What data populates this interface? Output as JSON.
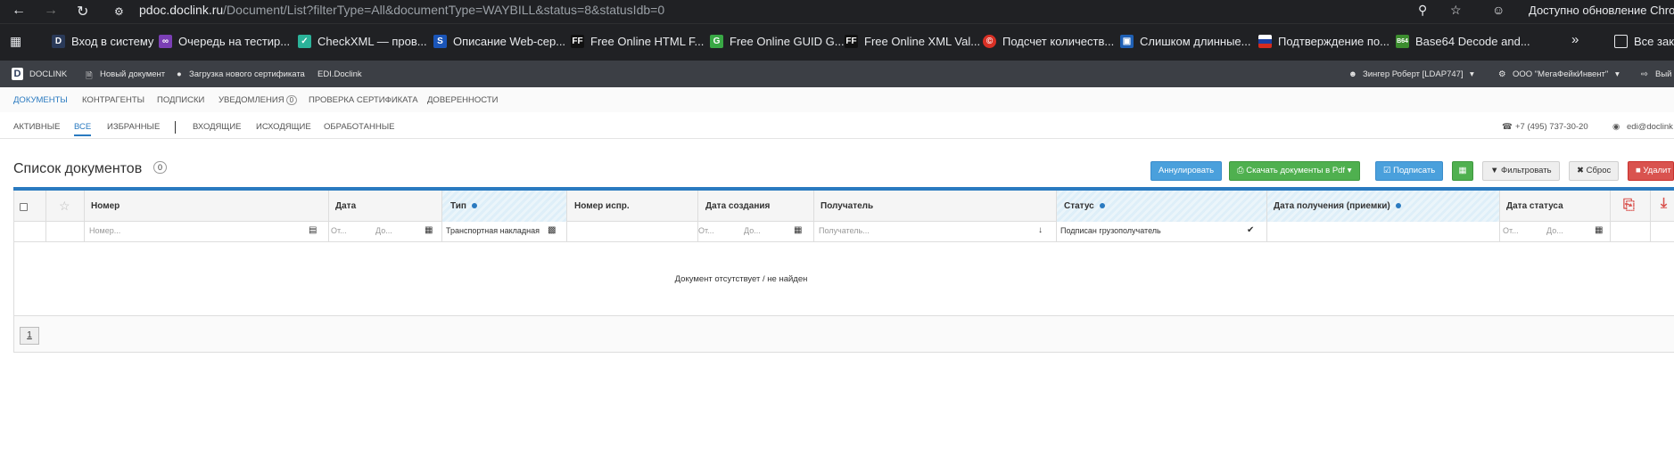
{
  "browser": {
    "url_host": "pdoc.doclink.ru",
    "url_path": "/Document/List?filterType=All&documentType=WAYBILL&status=8&statusIdb=0",
    "update_text": "Доступно обновление Chrom",
    "bookmarks": [
      {
        "label": "Вход в систему",
        "icon": "doclink-icon",
        "color": "#2a3a59"
      },
      {
        "label": "Очередь на тестир...",
        "icon": "visualstudio-icon",
        "color": "#7b3fb5"
      },
      {
        "label": "CheckXML — пров...",
        "icon": "checkxml-icon",
        "color": "#2bb39a"
      },
      {
        "label": "Описание Web-сер...",
        "icon": "swagger-icon",
        "color": "#1a55b8"
      },
      {
        "label": "Free Online HTML F...",
        "icon": "ff-icon",
        "color": "#111111"
      },
      {
        "label": "Free Online GUID G...",
        "icon": "guid-icon",
        "color": "#39a845"
      },
      {
        "label": "Free Online XML Val...",
        "icon": "ff-icon",
        "color": "#111111"
      },
      {
        "label": "Подсчет количеств...",
        "icon": "copyright-icon",
        "color": "#d93025"
      },
      {
        "label": "Слишком длинные...",
        "icon": "image-icon",
        "color": "#1e5fb4"
      },
      {
        "label": "Подтверждение по...",
        "icon": "flag-ru-icon",
        "color": "#d52b1e"
      },
      {
        "label": "Base64 Decode and...",
        "icon": "b64-icon",
        "color": "#3c8d2f"
      }
    ],
    "more_label": "»",
    "all_bookmarks": "Все закл"
  },
  "app": {
    "logo_letter": "D",
    "brand": "DOCLINK",
    "new_doc": "Новый документ",
    "load_cert": "Загрузка нового сертификата",
    "edi": "EDI.Doclink",
    "user": "Зингер Роберт [LDAP747]",
    "org": "ООО \"МегаФейкИнвент\"",
    "logout": "Вый"
  },
  "main_nav": [
    {
      "label": "Документы",
      "active": true
    },
    {
      "label": "Контрагенты",
      "active": false
    },
    {
      "label": "Подписки",
      "active": false
    },
    {
      "label": "Уведомления",
      "active": false,
      "badge": "0"
    },
    {
      "label": "Проверка сертификата",
      "active": false
    },
    {
      "label": "Доверенности",
      "active": false
    }
  ],
  "sub_nav": {
    "items": [
      {
        "label": "АКТИВНЫЕ",
        "active": false
      },
      {
        "label": "ВСЕ",
        "active": true
      },
      {
        "label": "ИЗБРАННЫЕ",
        "active": false
      },
      {
        "label": "ВХОДЯЩИЕ",
        "active": false
      },
      {
        "label": "ИСХОДЯЩИЕ",
        "active": false
      },
      {
        "label": "ОБРАБОТАННЫЕ",
        "active": false
      }
    ],
    "phone": "+7 (495) 737-30-20",
    "email": "edi@doclink"
  },
  "page": {
    "title": "Список документов",
    "count": "0"
  },
  "toolbar": {
    "annul": "Аннулировать",
    "download": "Скачать документы в Pdf",
    "sign": "Подписать",
    "filter": "Фильтровать",
    "reset": "Сброс",
    "delete": "Удалит"
  },
  "table": {
    "headers": {
      "number": "Номер",
      "date": "Дата",
      "type": "Тип",
      "fix_number": "Номер испр.",
      "created": "Дата создания",
      "recipient": "Получатель",
      "status": "Статус",
      "received": "Дата получения (приемки)",
      "status_date": "Дата статуса"
    },
    "filters": {
      "number_ph": "Номер...",
      "from_ph": "От...",
      "to_ph": "До...",
      "type_value": "Транспортная накладная",
      "recipient_ph": "Получатель...",
      "status_value": "Подписан грузополучатель"
    },
    "empty_message": "Документ отсутствует / не найден",
    "page_number": "1"
  }
}
